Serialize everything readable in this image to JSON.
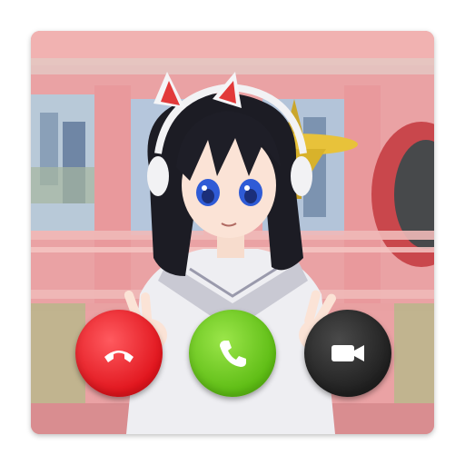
{
  "app": {
    "type": "incoming-call-screen"
  },
  "buttons": [
    {
      "id": "decline",
      "icon": "phone-hangup-icon",
      "color": "#e0141c"
    },
    {
      "id": "accept",
      "icon": "phone-icon",
      "color": "#5cbb13"
    },
    {
      "id": "video",
      "icon": "video-camera-icon",
      "color": "#1f1f1f"
    }
  ],
  "colors": {
    "background_wall": "#e9a3a5",
    "card_border": "#ffffff"
  }
}
